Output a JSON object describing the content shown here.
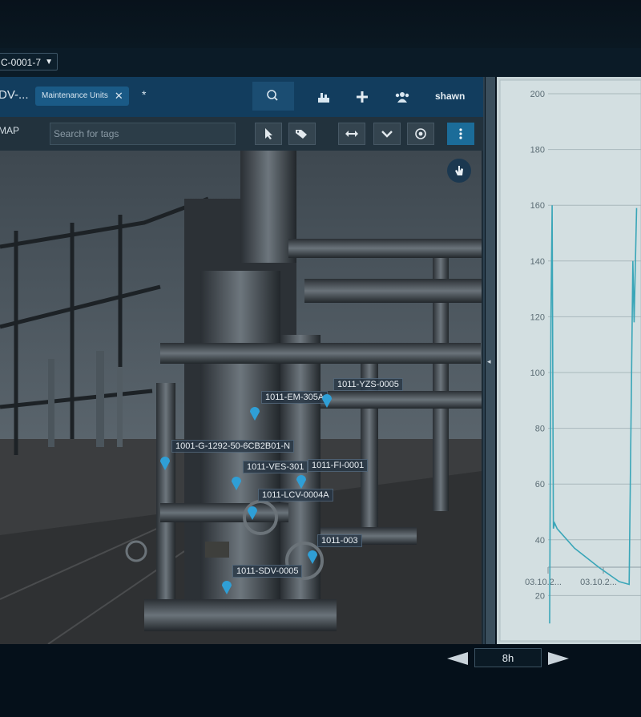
{
  "asset_selector": {
    "value": "C-0001-7"
  },
  "header": {
    "title": "DV-...",
    "filter_chip": "Maintenance Units",
    "star": "*",
    "user": "shawn"
  },
  "toolbar": {
    "map_tab": "MAP",
    "search_placeholder": "Search for tags"
  },
  "tags": [
    {
      "label": "1011-YZS-0005"
    },
    {
      "label": "1011-EM-305A"
    },
    {
      "label": "1001-G-1292-50-6CB2B01-N"
    },
    {
      "label": "1011-VES-301"
    },
    {
      "label": "1011-FI-0001"
    },
    {
      "label": "1011-LCV-0004A"
    },
    {
      "label": "1011-003"
    },
    {
      "label": "1011-SDV-0005"
    }
  ],
  "time_range": {
    "value": "8h"
  },
  "colors": {
    "header": "#123d5e",
    "accent": "#1b6c99",
    "line": "#3aa6b8",
    "logo": "#c9303a"
  },
  "chart_data": {
    "type": "line",
    "ylim": [
      0,
      200
    ],
    "yticks": [
      20,
      40,
      60,
      80,
      100,
      120,
      140,
      160,
      180,
      200
    ],
    "xticks": [
      "03.10.2...",
      "03.10.2..."
    ],
    "grid": true,
    "series": [
      {
        "values": [
          [
            0,
            10
          ],
          [
            0.5,
            118
          ],
          [
            1,
            160
          ],
          [
            1.5,
            44
          ],
          [
            2,
            46
          ],
          [
            3,
            44
          ],
          [
            10,
            37
          ],
          [
            20,
            30
          ],
          [
            28,
            25
          ],
          [
            32,
            24
          ],
          [
            33.5,
            140
          ],
          [
            34,
            118
          ],
          [
            35,
            159
          ]
        ]
      }
    ]
  }
}
